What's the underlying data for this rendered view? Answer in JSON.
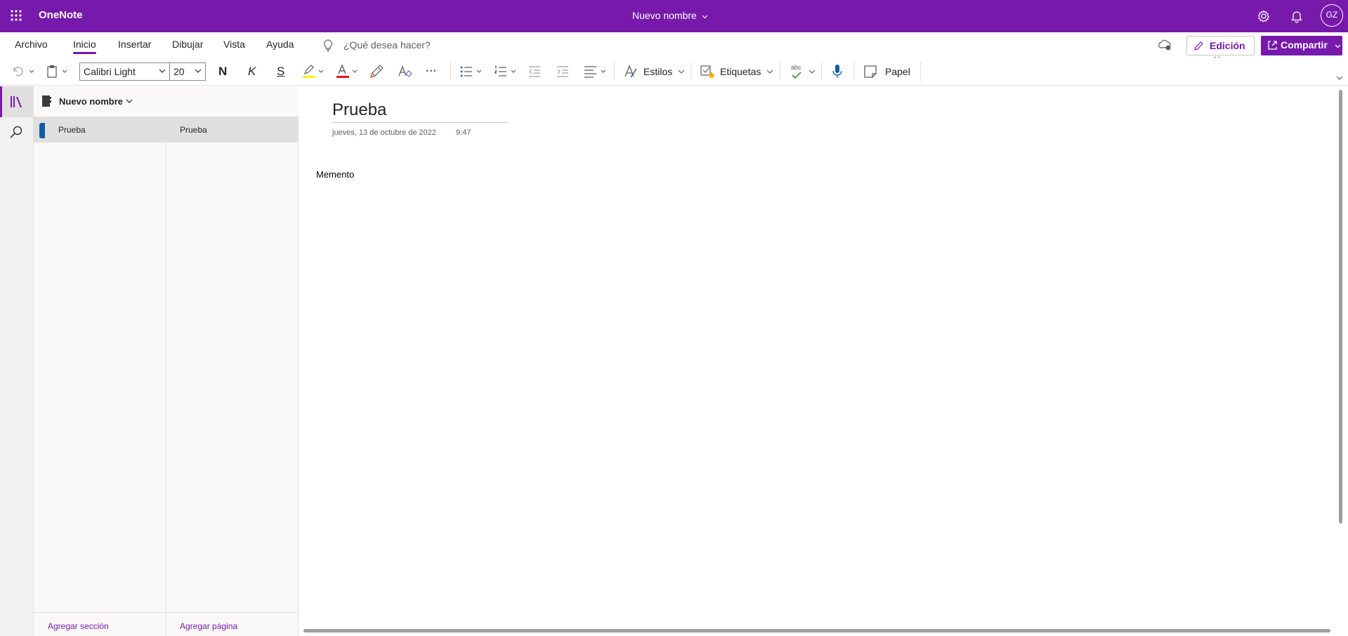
{
  "titlebar": {
    "app_name": "OneNote",
    "document_title": "Nuevo nombre",
    "avatar_initials": "GZ",
    "brand_color": "#7719aa"
  },
  "menu": {
    "tabs": [
      "Archivo",
      "Inicio",
      "Insertar",
      "Dibujar",
      "Vista",
      "Ayuda"
    ],
    "active_tab": "Inicio",
    "search_placeholder": "¿Qué desea hacer?",
    "edit_button": "Edición",
    "share_button": "Compartir"
  },
  "toolbar": {
    "font_name": "Calibri Light",
    "font_size": "20",
    "bold_label": "N",
    "italic_label": "K",
    "underline_label": "S",
    "styles_label": "Estilos",
    "tags_label": "Etiquetas",
    "spell_label": "abc",
    "paper_label": "Papel",
    "more_label": "···"
  },
  "notebook": {
    "name": "Nuevo nombre",
    "sections": [
      {
        "label": "Prueba",
        "color": "#0f5ca8"
      }
    ],
    "pages": [
      {
        "label": "Prueba"
      }
    ],
    "add_section": "Agregar sección",
    "add_page": "Agregar página"
  },
  "page": {
    "title": "Prueba",
    "date": "jueves, 13 de octubre de 2022",
    "time": "9:47",
    "body": "Memento"
  }
}
